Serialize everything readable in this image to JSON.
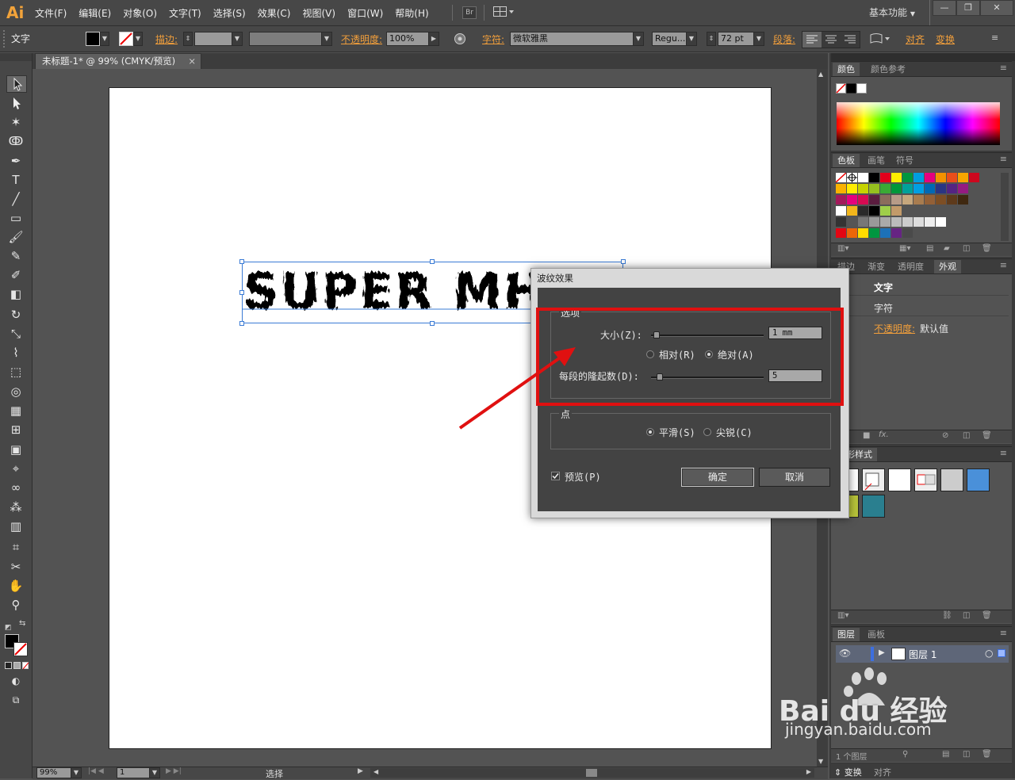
{
  "menubar": {
    "logo": "Ai",
    "items": [
      "文件(F)",
      "编辑(E)",
      "对象(O)",
      "文字(T)",
      "选择(S)",
      "效果(C)",
      "视图(V)",
      "窗口(W)",
      "帮助(H)"
    ],
    "bridge_label": "Br",
    "workspace": "基本功能",
    "win_controls": [
      "—",
      "❐",
      "✕"
    ]
  },
  "control_bar": {
    "mode_label": "文字",
    "stroke_label": "描边:",
    "opacity_label": "不透明度:",
    "opacity_value": "100%",
    "char_label": "字符:",
    "font_family": "微软雅黑",
    "font_style": "Regu...",
    "font_size": "72 pt",
    "para_label": "段落:",
    "align_label": "对齐",
    "transform_label": "变换"
  },
  "document": {
    "tab_title": "未标题-1* @ 99% (CMYK/预览)",
    "close_glyph": "×",
    "canvas_text": "SUPER MHESS"
  },
  "status_bar": {
    "zoom": "99%",
    "page": "1",
    "status_text": "选择"
  },
  "panels": {
    "color": {
      "tabs": [
        "颜色",
        "颜色参考"
      ]
    },
    "swatches": {
      "tabs": [
        "色板",
        "画笔",
        "符号"
      ]
    },
    "appearance": {
      "tabs": [
        "描边",
        "渐变",
        "透明度",
        "外观"
      ],
      "title": "文字",
      "row_char": "字符",
      "opacity_label": "不透明度:",
      "opacity_value": "默认值"
    },
    "graphic_styles": {
      "tabs": [
        "图形样式"
      ]
    },
    "layers": {
      "tabs": [
        "图层",
        "画板"
      ],
      "layer_name": "图层 1",
      "footer": "1 个图层"
    },
    "bottom_tabs": [
      "变换",
      "对齐"
    ]
  },
  "dialog": {
    "title": "波纹效果",
    "options_legend": "选项",
    "size_label": "大小(Z):",
    "size_value": "1 mm",
    "size_position": 0.02,
    "relative_label": "相对(R)",
    "absolute_label": "绝对(A)",
    "mode_selected": "绝对(A)",
    "ridges_label": "每段的隆起数(D):",
    "ridges_value": "5",
    "ridges_position": 0.05,
    "points_legend": "点",
    "smooth_label": "平滑(S)",
    "corner_label": "尖锐(C)",
    "points_selected": "平滑(S)",
    "preview_label": "预览(P)",
    "preview_checked": true,
    "ok_label": "确定",
    "cancel_label": "取消"
  },
  "watermark": {
    "brand": "Bai du 经验",
    "url": "jingyan.baidu.com"
  },
  "colors": {
    "accent_orange": "#f29f3b",
    "highlight_red": "#e01010",
    "ui_dark": "#474747"
  }
}
